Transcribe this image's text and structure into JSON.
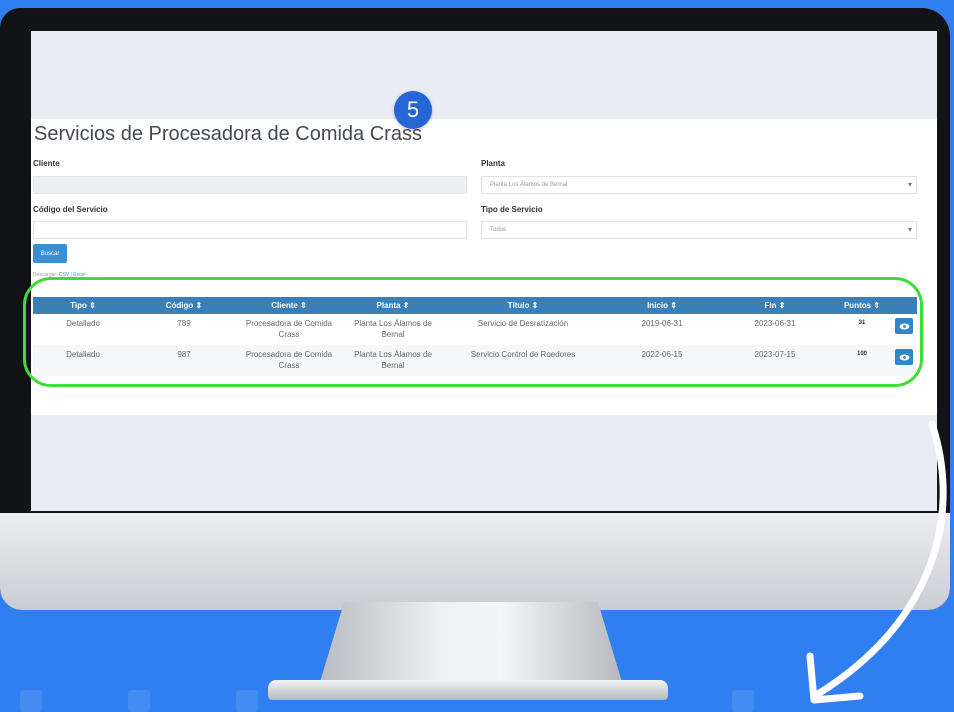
{
  "step_number": "5",
  "page": {
    "title": "Servicios de Procesadora de Comida Crass"
  },
  "form": {
    "cliente_label": "Cliente",
    "cliente_value": "",
    "planta_label": "Planta",
    "planta_value": "Planta Los Álamos de Bernal",
    "codigo_label": "Código del Servicio",
    "codigo_value": "",
    "tipo_label": "Tipo de Servicio",
    "tipo_value": "Todos",
    "search_button": "Buscar",
    "download_prefix": "Descargar:",
    "download_csv": "CSV",
    "download_sep": "|",
    "download_excel": "Excel"
  },
  "table": {
    "headers": [
      "Tipo ⇕",
      "Código ⇕",
      "Cliente ⇕",
      "Planta ⇕",
      "Título ⇕",
      "Inicio ⇕",
      "Fin ⇕",
      "Puntos ⇕"
    ],
    "rows": [
      [
        "Detallado",
        "789",
        "Procesadora de Comida Crass",
        "Planta Los Álamos de Bernal",
        "Servicio de Desratización",
        "2019-06-31",
        "2023-06-31",
        "31"
      ],
      [
        "Detallado",
        "987",
        "Procesadora de Comida Crass",
        "Planta Los Álamos de Bernal",
        "Servicio Control de Roedores",
        "2022-06-15",
        "2023-07-15",
        "100"
      ]
    ]
  },
  "colors": {
    "background": "#2f7ff0",
    "table_header": "#3a80b7",
    "highlight": "#3ddc3a",
    "badge": "#2466d3"
  }
}
